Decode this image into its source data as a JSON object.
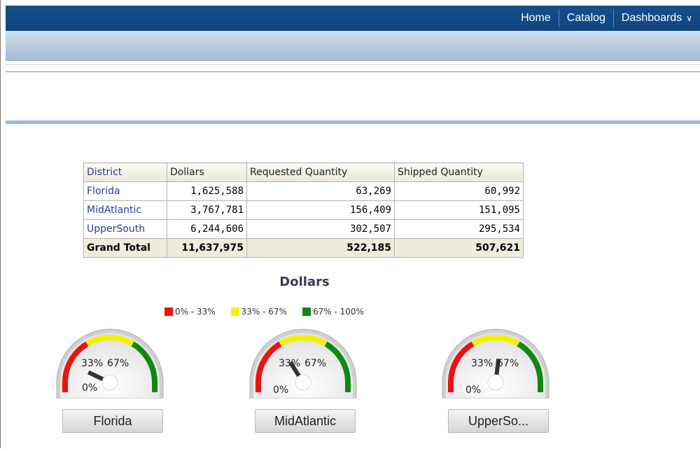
{
  "nav": {
    "home": "Home",
    "catalog": "Catalog",
    "dashboards": "Dashboards"
  },
  "table": {
    "headers": [
      "District",
      "Dollars",
      "Requested Quantity",
      "Shipped Quantity"
    ],
    "rows": [
      {
        "district": "Florida",
        "dollars": "1,625,588",
        "requested": "63,269",
        "shipped": "60,992"
      },
      {
        "district": "MidAtlantic",
        "dollars": "3,767,781",
        "requested": "156,409",
        "shipped": "151,095"
      },
      {
        "district": "UpperSouth",
        "dollars": "6,244,606",
        "requested": "302,507",
        "shipped": "295,534"
      }
    ],
    "total": {
      "label": "Grand Total",
      "dollars": "11,637,975",
      "requested": "522,185",
      "shipped": "507,621"
    }
  },
  "chart_data": {
    "type": "gauge",
    "title": "Dollars",
    "legend": [
      {
        "label": "0% - 33%",
        "color": "#ee1111"
      },
      {
        "label": "33% - 67%",
        "color": "#f2f200"
      },
      {
        "label": "67% - 100%",
        "color": "#118811"
      }
    ],
    "tick_labels": {
      "zero": "0%",
      "low": "33%",
      "high": "67%"
    },
    "gauges": [
      {
        "name": "Florida",
        "label": "Florida",
        "value_pct": 14
      },
      {
        "name": "MidAtlantic",
        "label": "MidAtlantic",
        "value_pct": 32
      },
      {
        "name": "UpperSouth",
        "label": "UpperSo...",
        "value_pct": 54
      }
    ]
  }
}
